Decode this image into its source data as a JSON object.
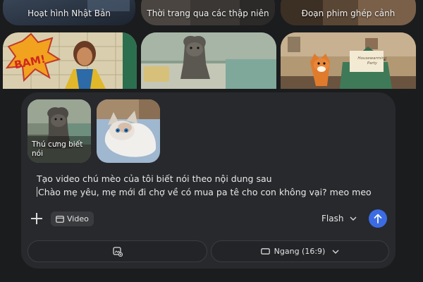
{
  "top_cards": [
    {
      "label": "Hoạt hình Nhật Bản"
    },
    {
      "label": "Thời trang qua các thập niên"
    },
    {
      "label": "Đoạn phim ghép cảnh"
    }
  ],
  "thumbnails": [
    {
      "caption": "BAM!"
    },
    {
      "caption": ""
    },
    {
      "caption": "Housewarming Party"
    }
  ],
  "attachments": [
    {
      "label": "Thú cưng biết nói"
    },
    {
      "label": ""
    }
  ],
  "prompt": {
    "line1": "Tạo video chú mèo của tôi biết nói theo nội dung sau",
    "line2": "Chào mẹ yêu, mẹ mới đi chợ về có mua pa tê cho con không vại? meo meo"
  },
  "toolbar": {
    "video_label": "Video",
    "model_label": "Flash"
  },
  "bottom": {
    "aspect_label": "Ngang (16:9)"
  },
  "colors": {
    "background": "#1b1c1e",
    "panel": "#28292c",
    "send_button": "#3b6ce4"
  }
}
